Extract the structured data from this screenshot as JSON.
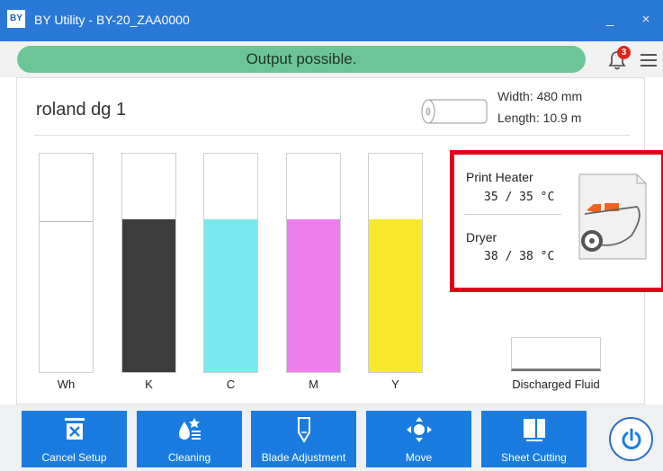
{
  "titlebar": {
    "logo": "BY",
    "title": "BY Utility - BY-20_ZAA0000",
    "minimize": "_",
    "close": "×"
  },
  "status": {
    "message": "Output possible.",
    "notification_count": "3"
  },
  "printer": {
    "name": "roland dg 1",
    "media_width": "Width: 480 mm",
    "media_length": "Length: 10.9 m"
  },
  "inks": [
    {
      "label": "Wh",
      "level": 0.69,
      "color": "#ffffff"
    },
    {
      "label": "K",
      "level": 0.7,
      "color": "#3c3c3c"
    },
    {
      "label": "C",
      "level": 0.7,
      "color": "#7ae8ec"
    },
    {
      "label": "M",
      "level": 0.7,
      "color": "#eb7eeb"
    },
    {
      "label": "Y",
      "level": 0.7,
      "color": "#f8ea2a"
    }
  ],
  "heater": {
    "print_heater_label": "Print Heater",
    "print_heater_value": "35 / 35 °C",
    "dryer_label": "Dryer",
    "dryer_value": "38 / 38 °C"
  },
  "discharged_fluid": {
    "label": "Discharged Fluid"
  },
  "toolbar": {
    "cancel_setup": "Cancel Setup",
    "cleaning": "Cleaning",
    "blade_adjustment": "Blade Adjustment",
    "move": "Move",
    "sheet_cutting": "Sheet Cutting"
  },
  "colors": {
    "titlebar": "#2b79d6",
    "status_ok": "#6cc596",
    "toolbar_button": "#1a7ce0",
    "heater_highlight": "#e0001b"
  }
}
